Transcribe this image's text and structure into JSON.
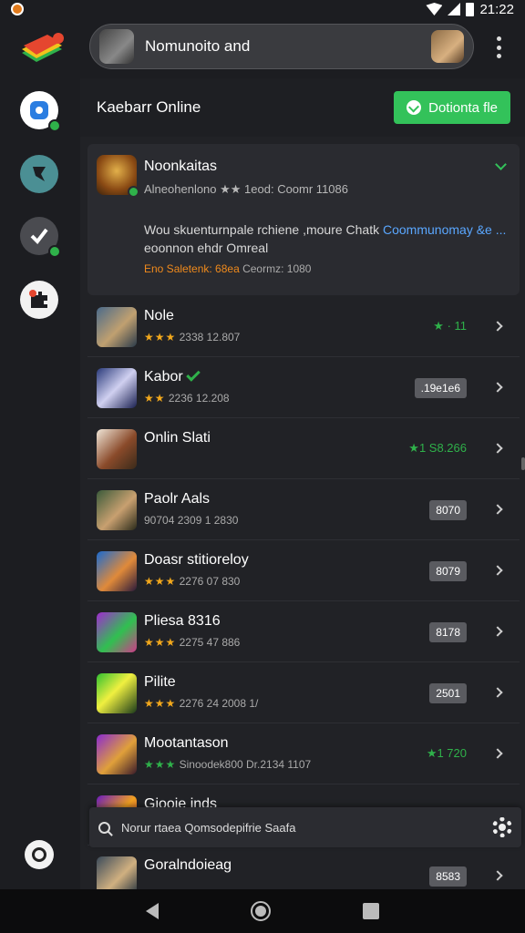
{
  "status": {
    "time": "21:22"
  },
  "topbar": {
    "title": "Nomunoito and"
  },
  "header": {
    "title": "Kaebarr Online",
    "download_label": "Dotionta fle"
  },
  "featured": {
    "title": "Noonkaitas",
    "meta": "Alneohenlono ★★ 1eod: Coomr 11086",
    "desc_line1": "Wou skuenturnpale rchiene ,moure Chatk",
    "desc_link": "Coommunomay &e ...",
    "desc_line2": "eoonnon ehdr Omreal",
    "stats_highlight": "Eno Saletenk: 68ea",
    "stats_rest": "Ceormz: 1080"
  },
  "rows": [
    {
      "title": "Nole",
      "stars": "★★★",
      "meta": "2338 12.807",
      "right_type": "green",
      "right": "★ · 11"
    },
    {
      "title": "Kabor",
      "stars": "★★",
      "meta": "2236 12.208",
      "right_type": "pill",
      "right": ".19e1e6",
      "verified": true
    },
    {
      "title": "Onlin Slati",
      "stars": "",
      "meta": "",
      "right_type": "green",
      "right": "★1 S8.266"
    },
    {
      "title": "Paolr Aals",
      "stars": "",
      "meta": "90704 2309 1 2830",
      "right_type": "pill",
      "right": "8070"
    },
    {
      "title": "Doasr stitioreloy",
      "stars": "★★★",
      "meta": "2276 07 830",
      "right_type": "pill",
      "right": "8079"
    },
    {
      "title": "Pliesa 8316",
      "stars": "★★★",
      "meta": "2275 47 886",
      "right_type": "pill",
      "right": "8178"
    },
    {
      "title": "Pilite",
      "stars": "★★★",
      "meta": "2276 24 2008 1/",
      "right_type": "pill",
      "right": "2501"
    },
    {
      "title": "Mootantason",
      "stars": "★★★",
      "stars_green": true,
      "meta": "Sinoodek800 Dr.2134 1107",
      "right_type": "green",
      "right": "★1 720"
    },
    {
      "title": "Giooie inds",
      "stars": "",
      "meta": "",
      "right_type": "none",
      "right": ""
    },
    {
      "title": "Goralndoieag",
      "stars": "",
      "meta": "",
      "right_type": "pill",
      "right": "8583"
    }
  ],
  "bottom_search": {
    "text": "Norur rtaea Qomsodepifrie Saafa"
  },
  "icons": {
    "logo": "paper-stack-logo",
    "side": [
      "blue-app-icon",
      "teal-shield-icon",
      "check-icon",
      "puzzle-icon"
    ],
    "location": "location-icon"
  }
}
